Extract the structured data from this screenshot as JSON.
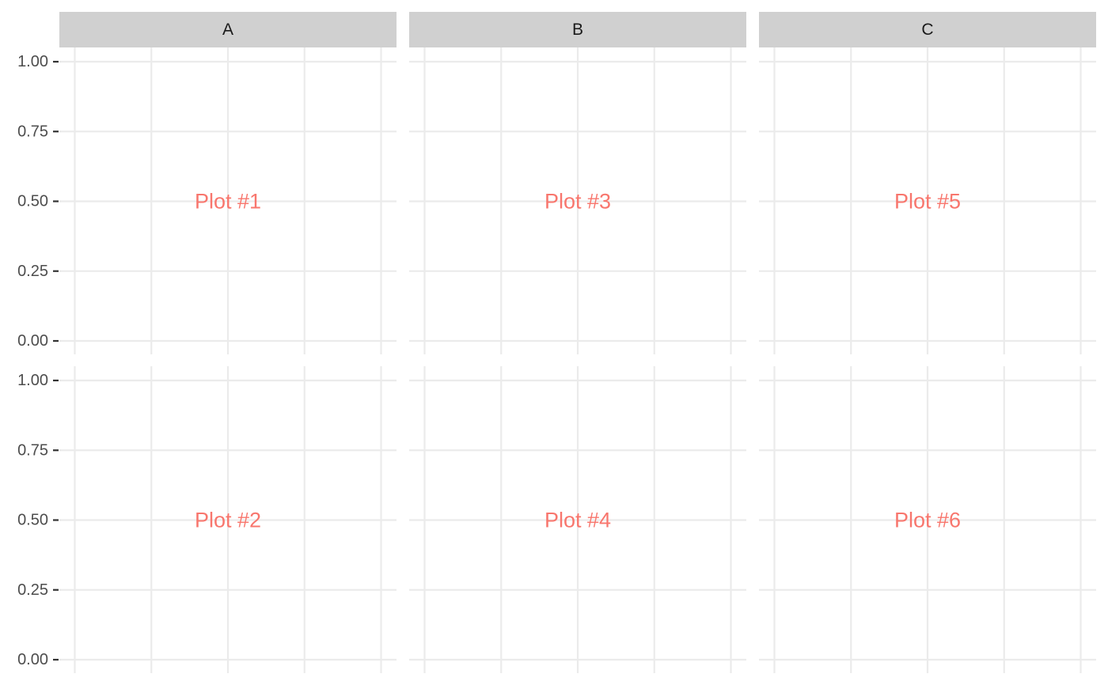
{
  "colors": {
    "strip_background": "#d0d0d0",
    "panel_background": "#ffffff",
    "grid_line": "#ebebeb",
    "tick_mark": "#333333",
    "tick_label": "#4d4d4d",
    "strip_label": "#1a1a1a",
    "annotation": "#f8766d"
  },
  "chart_data": {
    "type": "scatter",
    "title": "",
    "xlabel": "",
    "ylabel": "",
    "facet_columns": [
      "A",
      "B",
      "C"
    ],
    "facet_rows": 2,
    "ylim": [
      0,
      1
    ],
    "y_ticks": [
      0.0,
      0.25,
      0.5,
      0.75,
      1.0
    ],
    "y_tick_labels": [
      "0.00",
      "0.25",
      "0.50",
      "0.75",
      "1.00"
    ],
    "x_grid_count": 5,
    "grid": true,
    "panels": [
      {
        "column": "A",
        "row": 1,
        "annotation": "Plot #1",
        "annotation_y": 0.5
      },
      {
        "column": "A",
        "row": 2,
        "annotation": "Plot #2",
        "annotation_y": 0.5
      },
      {
        "column": "B",
        "row": 1,
        "annotation": "Plot #3",
        "annotation_y": 0.5
      },
      {
        "column": "B",
        "row": 2,
        "annotation": "Plot #4",
        "annotation_y": 0.5
      },
      {
        "column": "C",
        "row": 1,
        "annotation": "Plot #5",
        "annotation_y": 0.5
      },
      {
        "column": "C",
        "row": 2,
        "annotation": "Plot #6",
        "annotation_y": 0.5
      }
    ]
  }
}
